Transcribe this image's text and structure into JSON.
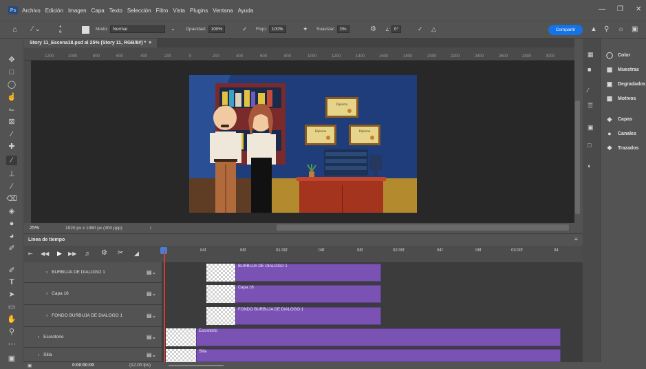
{
  "menubar": {
    "logo": "Ps",
    "items": [
      "Archivo",
      "Edición",
      "Imagen",
      "Capa",
      "Texto",
      "Selección",
      "Filtro",
      "Vista",
      "Plugins",
      "Ventana",
      "Ayuda"
    ]
  },
  "options": {
    "brush_size": "6",
    "mode_label": "Modo:",
    "mode_value": "Normal",
    "opacity_label": "Opacidad:",
    "opacity_value": "100%",
    "flow_label": "Flujo:",
    "flow_value": "100%",
    "smooth_label": "Suavizar:",
    "smooth_value": "0%",
    "angle_value": "0°",
    "share_label": "Compartir"
  },
  "document": {
    "tab_title": "Story 11_Escena18.psd al 25% (Story 11, RGB/8#) *",
    "zoom": "25%",
    "doc_info": "1920 px x 1080 px (300 ppp)"
  },
  "ruler": [
    "1200",
    "1000",
    "800",
    "600",
    "400",
    "200",
    "0",
    "200",
    "400",
    "600",
    "800",
    "1000",
    "1200",
    "1400",
    "1600",
    "1800",
    "2000",
    "2200",
    "2400",
    "2600",
    "2800",
    "3000"
  ],
  "timeline": {
    "title": "Línea de tiempo",
    "time_marks": [
      "04f",
      "08f",
      "01:00f",
      "04f",
      "08f",
      "02:00f",
      "04f",
      "08f",
      "03:00f",
      "04"
    ],
    "current_time": "0:00:00:00",
    "fps": "(12.00 fps)",
    "layers": [
      {
        "name": "BURBUJA DE DIALOGO 1",
        "clip": "BURBUJA DE DIALOGO 1"
      },
      {
        "name": "Capa 16",
        "clip": "Capa 16"
      },
      {
        "name": "FONDO BURBUJA DE DIALOGO 1",
        "clip": "FONDO BURBUJA DE DIALOGO 1"
      },
      {
        "name": "Escrotorio",
        "clip": "Escrotorio"
      },
      {
        "name": "Silla",
        "clip": "Silla"
      }
    ]
  },
  "panels": {
    "group1": [
      "Color",
      "Muestras",
      "Degradados",
      "Motivos"
    ],
    "group2": [
      "Capas",
      "Canales",
      "Trazados"
    ]
  },
  "scene": {
    "diploma_text": "Diploma"
  },
  "colors": {
    "accent": "#1473e6",
    "clip": "#7a52b4",
    "playhead": "#d63b3b"
  }
}
